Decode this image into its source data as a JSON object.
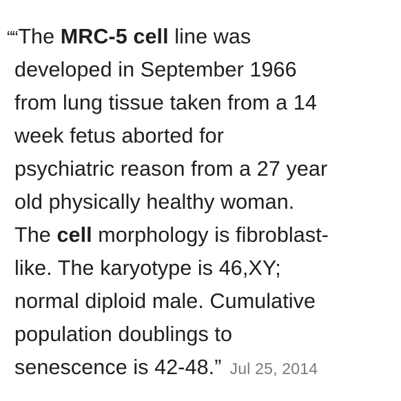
{
  "quote": {
    "open_quote": "““",
    "lines": [
      [
        "The ",
        "MRC-5 cell",
        " line was"
      ],
      [
        "developed in September 1966"
      ],
      [
        "from lung tissue taken from a 14"
      ],
      [
        "week fetus aborted for"
      ],
      [
        "psychiatric reason from a 27 year"
      ],
      [
        "old physically healthy woman."
      ],
      [
        "The ",
        "cell",
        " morphology is fibroblast-"
      ],
      [
        "like. The karyotype is 46,XY;"
      ],
      [
        "normal diploid male. Cumulative"
      ],
      [
        "population doublings to"
      ],
      [
        "senescence is 42-48.”"
      ]
    ],
    "date": "Jul 25, 2014"
  }
}
